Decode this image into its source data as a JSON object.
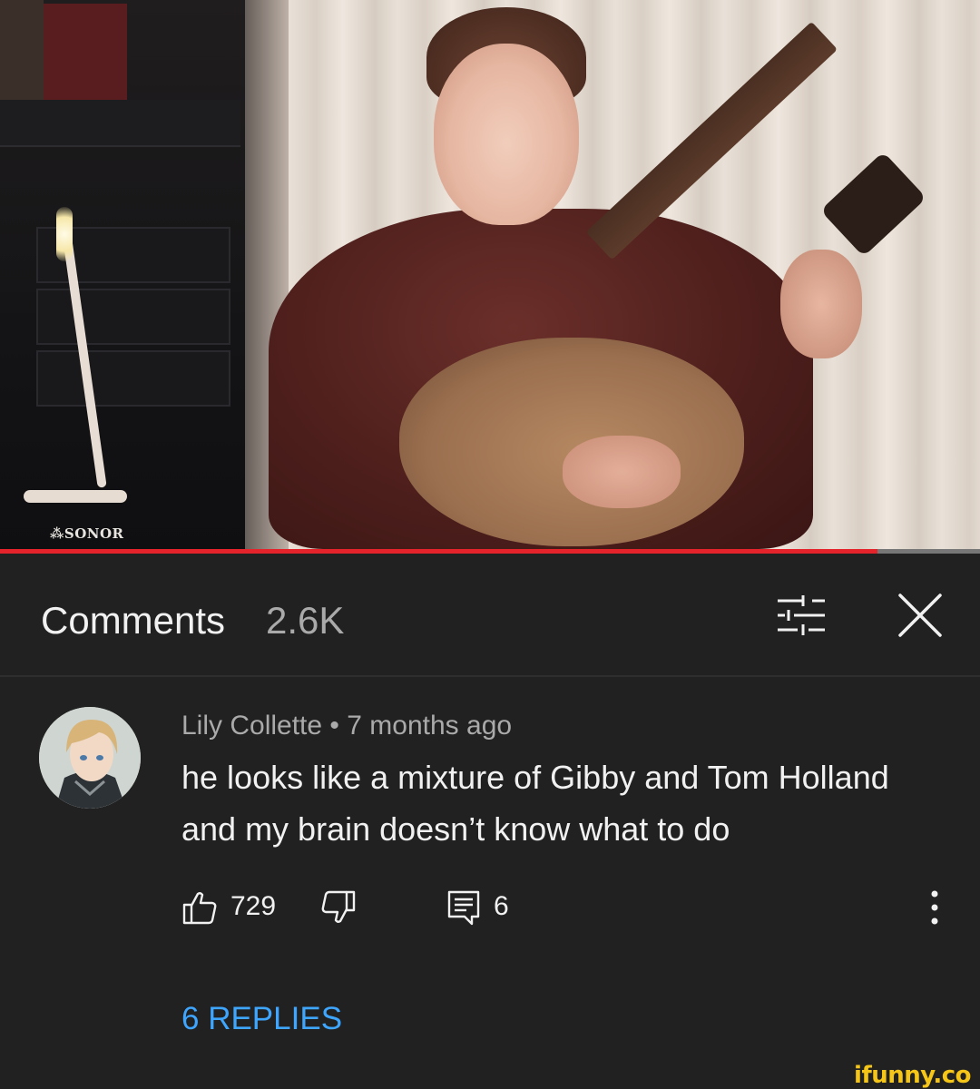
{
  "video": {
    "brand_text": "SONOR",
    "progress": 0.895,
    "progress_color": "#e5232a"
  },
  "comments_header": {
    "title": "Comments",
    "count": "2.6K",
    "filter_icon": "sort-filter-icon",
    "close_icon": "close-icon"
  },
  "comment": {
    "author": "Lily Collette",
    "separator": "•",
    "time": "7 months ago",
    "text": "he looks like a mixture of Gibby and Tom Holland and my brain doesn’t know what to do",
    "likes": "729",
    "reply_count": "6",
    "replies_link": "6 REPLIES",
    "like_icon": "thumbs-up-icon",
    "dislike_icon": "thumbs-down-icon",
    "reply_icon": "comment-icon",
    "more_icon": "more-vertical-icon"
  },
  "colors": {
    "background": "#212121",
    "text_primary": "#f1f1f1",
    "text_secondary": "#aaaaaa",
    "link": "#3ea6ff",
    "watermark": "#f5c518"
  },
  "watermark": "ifunny.co"
}
